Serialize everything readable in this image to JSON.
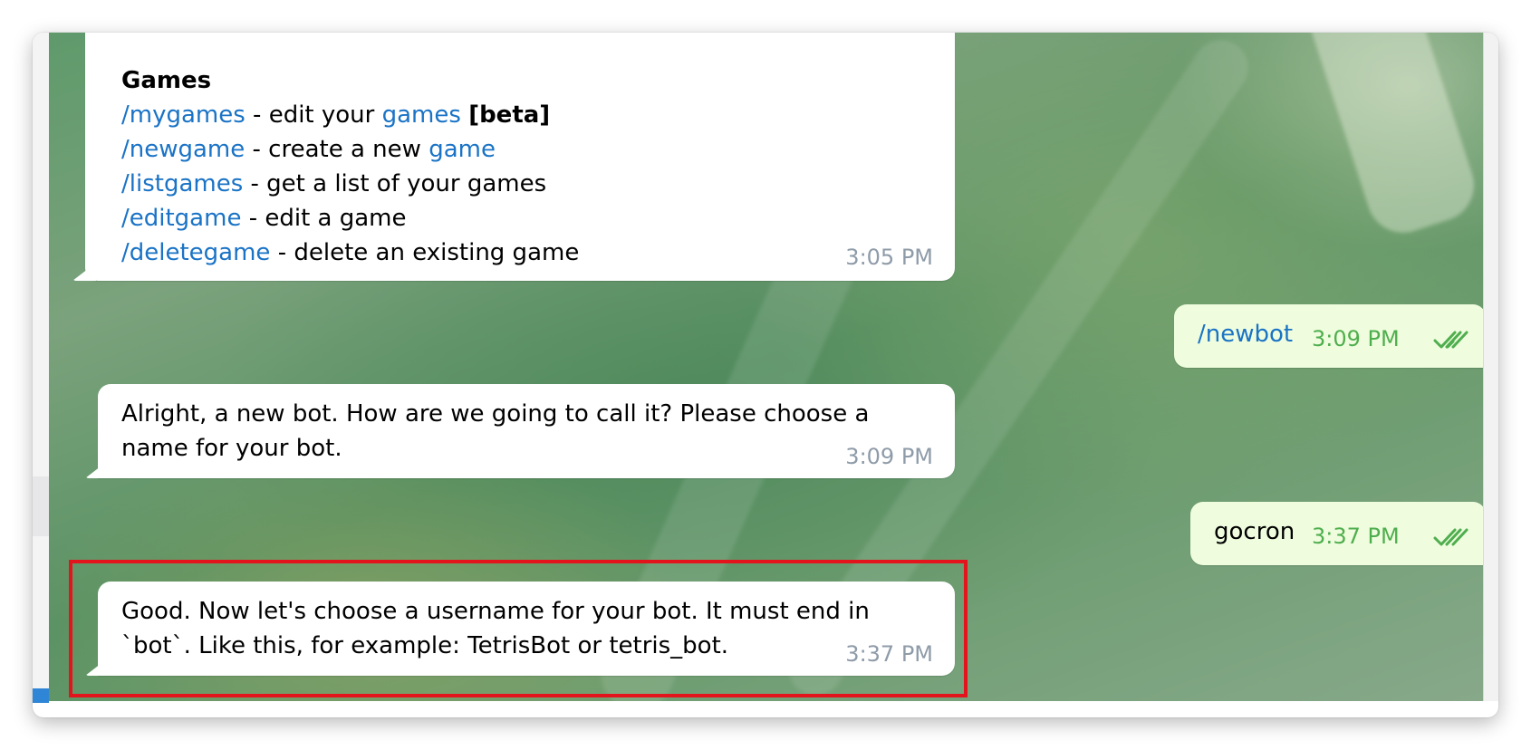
{
  "colors": {
    "link": "#1a73c6",
    "outgoing_bubble": "#effdde",
    "outgoing_time": "#4fae4e",
    "incoming_time": "#8e9ba8",
    "highlight_border": "#e3141b"
  },
  "messages": {
    "games_help": {
      "heading": "Games",
      "lines": [
        {
          "command": "/mygames",
          "text_before": " - edit your ",
          "link": "games",
          "text_after": " ",
          "bold": "[beta]"
        },
        {
          "command": "/newgame",
          "text_before": " - create a new ",
          "link": "game"
        },
        {
          "command": "/listgames",
          "text": " - get a list of your games"
        },
        {
          "command": "/editgame",
          "text": " - edit a game"
        },
        {
          "command": "/deletegame",
          "text": " - delete an existing game"
        }
      ],
      "time": "3:05 PM"
    },
    "newbot": {
      "command": "/newbot",
      "time": "3:09 PM",
      "status_icon": "double-check-icon"
    },
    "alright": {
      "text": "Alright, a new bot. How are we going to call it? Please choose a\nname for your bot.",
      "time": "3:09 PM"
    },
    "gocron": {
      "text": "gocron",
      "time": "3:37 PM",
      "status_icon": "double-check-icon"
    },
    "username": {
      "text": "Good. Now let's choose a username for your bot. It must end in\n`bot`. Like this, for example: TetrisBot or tetris_bot.",
      "time": "3:37 PM"
    }
  }
}
